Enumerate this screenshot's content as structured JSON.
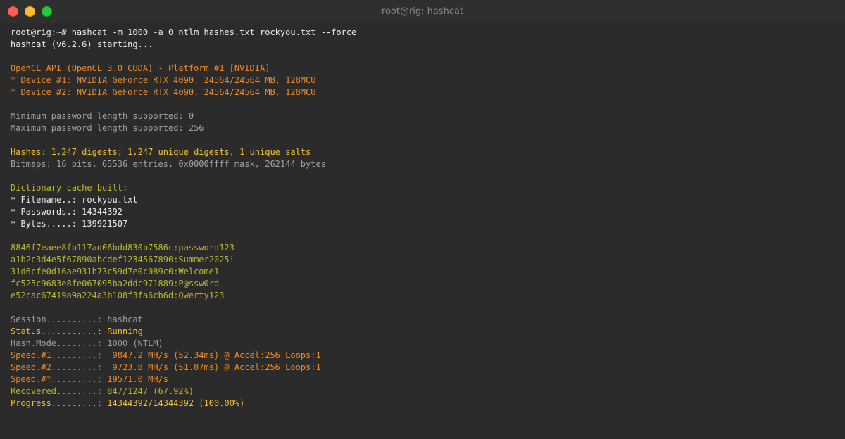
{
  "window": {
    "title": "root@rig: hashcat"
  },
  "terminal": {
    "lines": [
      {
        "text": "root@rig:~# hashcat -m 1000 -a 0 ntlm_hashes.txt rockyou.txt --force",
        "color": "white"
      },
      {
        "text": "hashcat (v6.2.6) starting...",
        "color": "white"
      },
      {
        "text": "",
        "color": "white"
      },
      {
        "text": "OpenCL API (OpenCL 3.0 CUDA) - Platform #1 [NVIDIA]",
        "color": "orange"
      },
      {
        "text": "* Device #1: NVIDIA GeForce RTX 4090, 24564/24564 MB, 128MCU",
        "color": "orange"
      },
      {
        "text": "* Device #2: NVIDIA GeForce RTX 4090, 24564/24564 MB, 128MCU",
        "color": "orange"
      },
      {
        "text": "",
        "color": "white"
      },
      {
        "text": "Minimum password length supported: 0",
        "color": "gray"
      },
      {
        "text": "Maximum password length supported: 256",
        "color": "gray"
      },
      {
        "text": "",
        "color": "white"
      },
      {
        "text": "Hashes: 1,247 digests; 1,247 unique digests, 1 unique salts",
        "color": "yellow"
      },
      {
        "text": "Bitmaps: 16 bits, 65536 entries, 0x0000ffff mask, 262144 bytes",
        "color": "gray"
      },
      {
        "text": "",
        "color": "white"
      },
      {
        "text": "Dictionary cache built:",
        "color": "olive"
      },
      {
        "text": "* Filename..: rockyou.txt",
        "color": "white"
      },
      {
        "text": "* Passwords.: 14344392",
        "color": "white"
      },
      {
        "text": "* Bytes.....: 139921507",
        "color": "white"
      },
      {
        "text": "",
        "color": "white"
      },
      {
        "text": "8846f7eaee8fb117ad06bdd830b7586c:password123",
        "color": "olive"
      },
      {
        "text": "a1b2c3d4e5f67890abcdef1234567890:Summer2025!",
        "color": "olive"
      },
      {
        "text": "31d6cfe0d16ae931b73c59d7e0c089c0:Welcome1",
        "color": "olive"
      },
      {
        "text": "fc525c9683e8fe067095ba2ddc971889:P@ssw0rd",
        "color": "olive"
      },
      {
        "text": "e52cac67419a9a224a3b108f3fa6cb6d:Qwerty123",
        "color": "olive"
      },
      {
        "text": "",
        "color": "white"
      },
      {
        "text": "Session..........: hashcat",
        "color": "gray"
      },
      {
        "text": "Status...........: Running",
        "color": "yellow"
      },
      {
        "text": "Hash.Mode........: 1000 (NTLM)",
        "color": "gray"
      },
      {
        "text": "Speed.#1.........:  9847.2 MH/s (52.34ms) @ Accel:256 Loops:1",
        "color": "orange"
      },
      {
        "text": "Speed.#2.........:  9723.8 MH/s (51.87ms) @ Accel:256 Loops:1",
        "color": "orange"
      },
      {
        "text": "Speed.#*.........: 19571.0 MH/s",
        "color": "orange"
      },
      {
        "text": "Recovered........: 847/1247 (67.92%)",
        "color": "olive"
      },
      {
        "text": "Progress.........: 14344392/14344392 (100.00%)",
        "color": "yellow"
      }
    ]
  },
  "colors": {
    "background": "#2b2b2b",
    "titlebar": "#2f2f2f",
    "white": "#ededed",
    "orange": "#f08a24",
    "gray": "#a2a2a2",
    "yellow": "#f2c230",
    "olive": "#b9b82e",
    "close": "#ff5f57",
    "minimize": "#febc2e",
    "maximize": "#28c840"
  }
}
